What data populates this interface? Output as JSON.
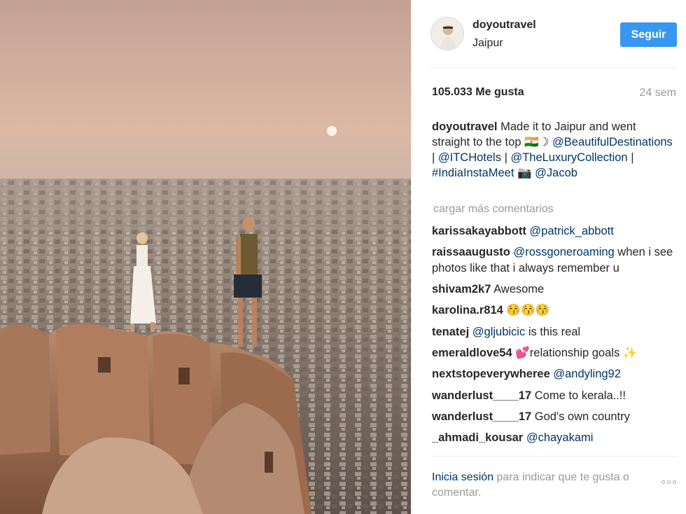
{
  "post": {
    "photo_alt": "Couple standing on Jaipur fort wall at sunset"
  },
  "header": {
    "username": "doyoutravel",
    "location": "Jaipur",
    "follow_label": "Seguir"
  },
  "stats": {
    "likes": "105.033 Me gusta",
    "time": "24 sem"
  },
  "caption": {
    "username": "doyoutravel",
    "text_1": " Made it to Jaipur and went straight to the top ",
    "emoji_1": "🇮🇳☽",
    "mention_1": "@BeautifulDestinations",
    "sep_1": " | ",
    "mention_2": "@ITCHotels",
    "sep_2": " | ",
    "mention_3": "@TheLuxuryCollection",
    "sep_3": " | ",
    "hashtag_1": "#IndiaInstaMeet",
    "camera_emoji": "📷",
    "mention_4": "@Jacob"
  },
  "load_more": "cargar más comentarios",
  "comments": [
    {
      "user": "karissakayabbott",
      "mention": "@patrick_abbott",
      "text": ""
    },
    {
      "user": "raissaaugusto",
      "mention": "@rossgoneroaming",
      "text": " when i see photos like that i always remember u"
    },
    {
      "user": "shivam2k7",
      "mention": "",
      "text": " Awesome"
    },
    {
      "user": "karolina.r814",
      "mention": "",
      "text": " 😚😚😚"
    },
    {
      "user": "tenatej",
      "mention": "@gljubicic",
      "text": " is this real"
    },
    {
      "user": "emeraldlove54",
      "mention": "",
      "text": " 💕relationship goals ✨"
    },
    {
      "user": "nextstopeverywheree",
      "mention": "@andyling92",
      "text": ""
    },
    {
      "user": "wanderlust____17",
      "mention": "",
      "text": " Come to kerala..!!"
    },
    {
      "user": "wanderlust____17",
      "mention": "",
      "text": " God's own country"
    },
    {
      "user": "_ahmadi_kousar",
      "mention": "@chayakami",
      "text": ""
    }
  ],
  "login": {
    "link": "Inicia sesión",
    "text": " para indicar que te gusta o comentar."
  },
  "colors": {
    "follow_button": "#3897f0",
    "link": "#003569",
    "muted": "#999999"
  },
  "icons": {
    "more": "more-options-icon"
  }
}
